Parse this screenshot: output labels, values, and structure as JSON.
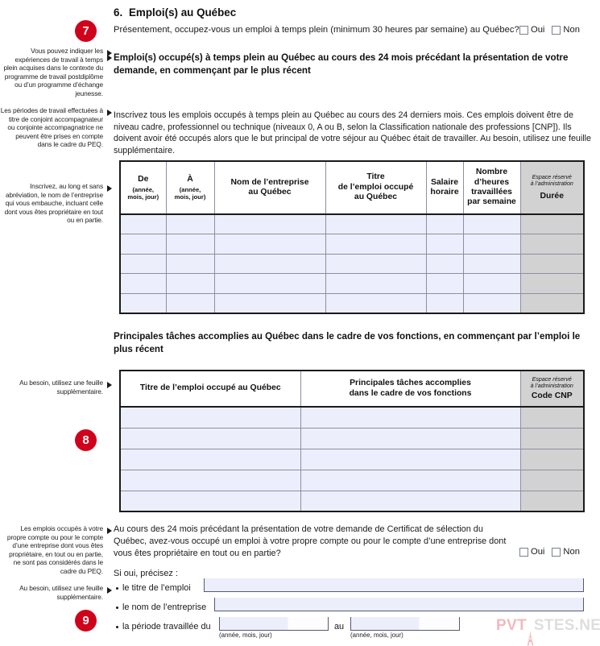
{
  "section": {
    "number": "6.",
    "title": "Emploi(s) au Québec"
  },
  "question_fulltime": {
    "text": "Présentement, occupez-vous un emploi à temps plein (minimum 30 heures par semaine) au Québec?",
    "oui": "Oui",
    "non": "Non"
  },
  "bold_intro": "Emploi(s) occupé(s) à temps plein au Québec au cours des 24 mois précédant la présentation de votre demande, en commençant par le plus récent",
  "instructions": "Inscrivez tous les emplois occupés à temps plein au Québec au cours des 24 derniers mois. Ces emplois doivent être de niveau cadre, professionnel ou technique (niveaux 0, A ou B, selon la Classification nationale des professions [CNP]). Ils doivent avoir été occupés alors que le but principal de votre séjour au Québec était de travailler. Au besoin, utilisez une feuille supplémentaire.",
  "margin_notes": [
    {
      "id": "note-postdiplome",
      "text": "Vous pouvez indiquer les expériences de travail à temps plein acquises dans le contexte du programme de travail postdiplôme ou d’un programme d’échange jeunesse."
    },
    {
      "id": "note-conjoint",
      "text": "Les périodes de travail effectuées à titre de conjoint accompagnateur ou conjointe accompagnatrice ne peuvent être prises en compte dans le cadre du PEQ."
    },
    {
      "id": "note-entreprise",
      "text": "Inscrivez, au long et sans abréviation, le nom de l’entreprise qui vous embauche, incluant celle dont vous êtes propriétaire en tout ou en partie."
    },
    {
      "id": "note-feuille-1",
      "text": "Au besoin, utilisez une feuille supplémentaire."
    },
    {
      "id": "note-peq-propre-compte",
      "text": "Les emplois occupés à votre propre compte ou pour le compte d’une entreprise dont vous êtes propriétaire, en tout ou en partie, ne sont pas considérés dans le cadre du PEQ."
    },
    {
      "id": "note-feuille-2",
      "text": "Au besoin, utilisez une feuille supplémentaire."
    }
  ],
  "badges": [
    {
      "id": "badge-7",
      "label": "7"
    },
    {
      "id": "badge-8",
      "label": "8"
    },
    {
      "id": "badge-9",
      "label": "9"
    }
  ],
  "table_employment": {
    "columns": [
      {
        "title": "De",
        "sub": "(année,\nmois, jour)"
      },
      {
        "title": "À",
        "sub": "(année,\nmois, jour)"
      },
      {
        "title": "Nom de l’entreprise\nau Québec",
        "sub": ""
      },
      {
        "title": "Titre\nde l’emploi occupé\nau Québec",
        "sub": ""
      },
      {
        "title": "Salaire\nhoraire",
        "sub": ""
      },
      {
        "title": "Nombre\nd’heures\ntravaillées\npar semaine",
        "sub": ""
      }
    ],
    "admin_column": {
      "reserved": "Espace réservé\nà l’administration",
      "label": "Durée"
    },
    "row_count": 5,
    "rows": [
      [
        "",
        "",
        "",
        "",
        "",
        "",
        ""
      ],
      [
        "",
        "",
        "",
        "",
        "",
        "",
        ""
      ],
      [
        "",
        "",
        "",
        "",
        "",
        "",
        ""
      ],
      [
        "",
        "",
        "",
        "",
        "",
        "",
        ""
      ],
      [
        "",
        "",
        "",
        "",
        "",
        "",
        ""
      ]
    ]
  },
  "bold_tasks": "Principales tâches accomplies au Québec dans le cadre de vos fonctions, en commençant par l’emploi le plus récent",
  "table_tasks": {
    "columns": [
      {
        "title": "Titre de l’emploi occupé au Québec"
      },
      {
        "title": "Principales tâches accomplies\ndans le cadre de vos fonctions"
      }
    ],
    "admin_column": {
      "reserved": "Espace réservé\nà l’administration",
      "label": "Code CNP"
    },
    "row_count": 5,
    "rows": [
      [
        "",
        "",
        ""
      ],
      [
        "",
        "",
        ""
      ],
      [
        "",
        "",
        ""
      ],
      [
        "",
        "",
        ""
      ],
      [
        "",
        "",
        ""
      ]
    ]
  },
  "question_own_business": {
    "text": "Au cours des 24 mois précédant la présentation de votre demande de Certificat de sélection du Québec, avez-vous occupé un emploi à votre propre compte ou pour le compte d’une entreprise dont vous êtes propriétaire en tout ou en partie?",
    "oui": "Oui",
    "non": "Non"
  },
  "si_oui": "Si oui, précisez :",
  "detail_fields": [
    {
      "label": "le titre de l’emploi",
      "value": "",
      "caption": ""
    },
    {
      "label": "le nom de l’entreprise",
      "value": "",
      "caption": ""
    },
    {
      "label": "la période travaillée du",
      "value": "",
      "caption": "(année, mois, jour)",
      "mid_label": "au",
      "value2": "",
      "caption2": "(année, mois, jour)"
    }
  ],
  "watermark": {
    "part1": "PVT",
    "part2": "STES.NET"
  },
  "colors": {
    "badge_red": "#d0021b",
    "field_fill": "#eceefb",
    "admin_fill": "#d2d2d2",
    "rule": "#1a1a1a"
  }
}
